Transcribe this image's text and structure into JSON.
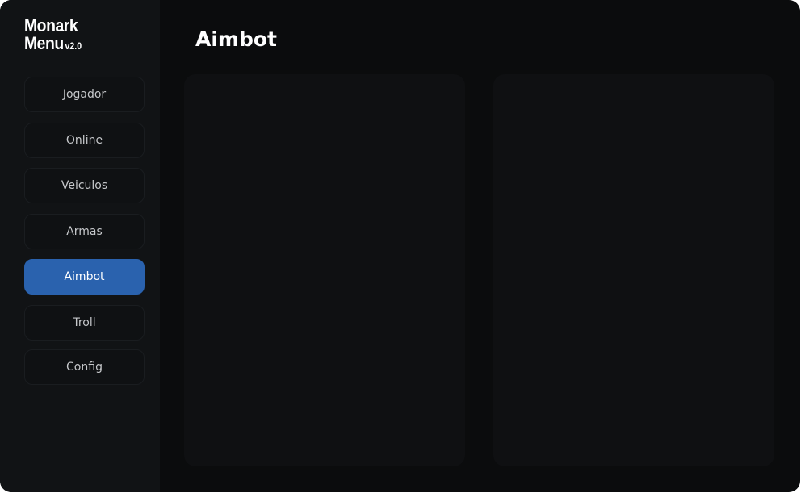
{
  "brand": {
    "line1": "Monark",
    "line2": "Menu",
    "version": "v2.0"
  },
  "sidebar": {
    "items": [
      {
        "label": "Jogador",
        "active": false
      },
      {
        "label": "Online",
        "active": false
      },
      {
        "label": "Veiculos",
        "active": false
      },
      {
        "label": "Armas",
        "active": false
      },
      {
        "label": "Aimbot",
        "active": true
      },
      {
        "label": "Troll",
        "active": false
      },
      {
        "label": "Config",
        "active": false
      }
    ]
  },
  "main": {
    "title": "Aimbot"
  },
  "colors": {
    "accent": "#2a62ae",
    "window_bg": "#0b0c0d",
    "sidebar_bg": "#111315",
    "panel_bg": "#0f1012"
  }
}
